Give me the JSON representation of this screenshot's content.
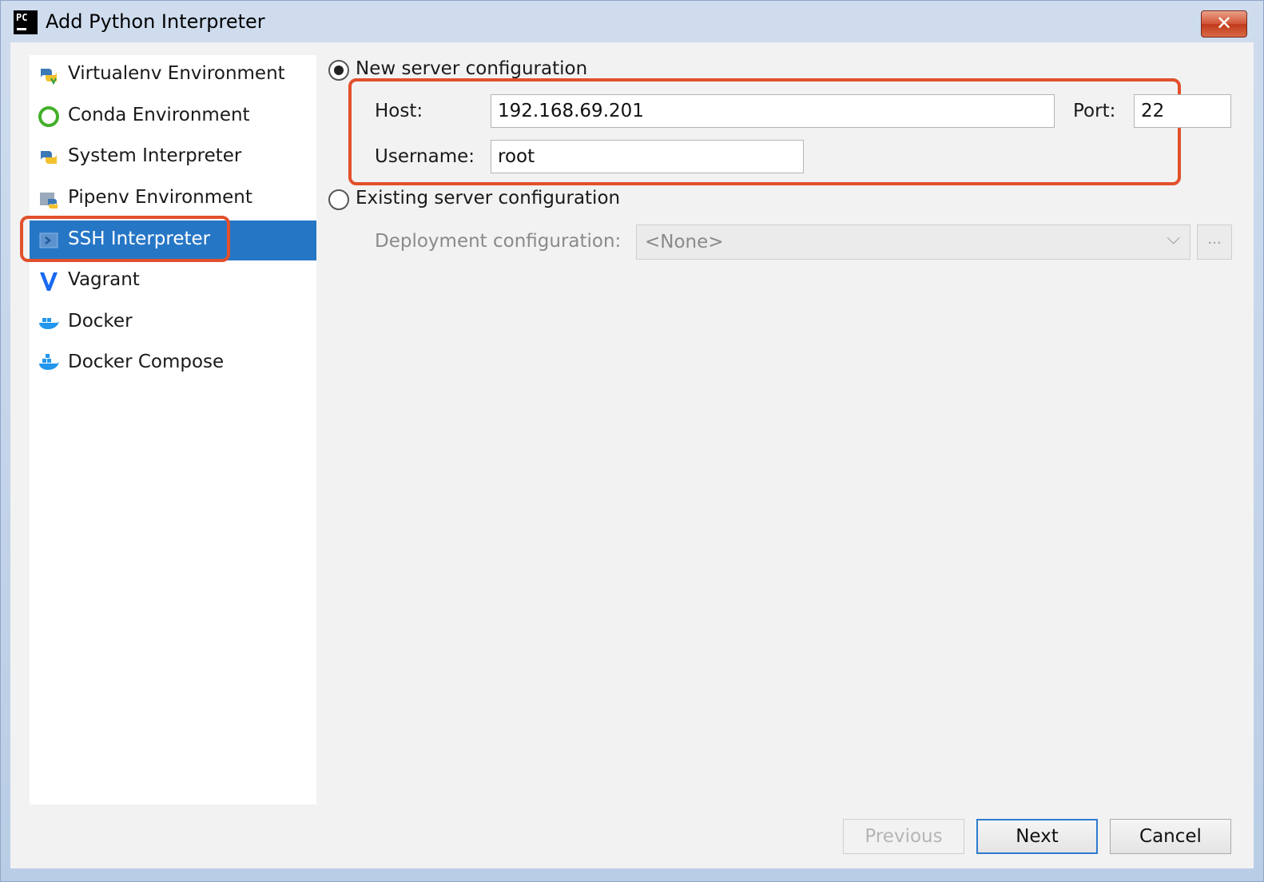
{
  "window": {
    "title": "Add Python Interpreter",
    "app_icon_text": "PC",
    "close_glyph": "✕"
  },
  "sidebar": {
    "items": [
      {
        "label": "Virtualenv Environment",
        "icon": "virtualenv-icon",
        "selected": false
      },
      {
        "label": "Conda Environment",
        "icon": "conda-icon",
        "selected": false
      },
      {
        "label": "System Interpreter",
        "icon": "python-icon",
        "selected": false
      },
      {
        "label": "Pipenv Environment",
        "icon": "pipenv-icon",
        "selected": false
      },
      {
        "label": "SSH Interpreter",
        "icon": "ssh-icon",
        "selected": true
      },
      {
        "label": "Vagrant",
        "icon": "vagrant-icon",
        "selected": false
      },
      {
        "label": "Docker",
        "icon": "docker-icon",
        "selected": false
      },
      {
        "label": "Docker Compose",
        "icon": "docker-compose-icon",
        "selected": false
      }
    ]
  },
  "main": {
    "new_server": {
      "label": "New server configuration",
      "checked": true,
      "host_label": "Host:",
      "host_value": "192.168.69.201",
      "port_label": "Port:",
      "port_value": "22",
      "username_label": "Username:",
      "username_value": "root"
    },
    "existing_server": {
      "label": "Existing server configuration",
      "checked": false,
      "deployment_label": "Deployment configuration:",
      "deployment_value": "<None>",
      "browse_label": "..."
    }
  },
  "footer": {
    "previous_label": "Previous",
    "next_label": "Next",
    "cancel_label": "Cancel"
  },
  "colors": {
    "selection": "#2676c6",
    "annotation": "#e2502c",
    "close_button": "#c03a1a"
  }
}
